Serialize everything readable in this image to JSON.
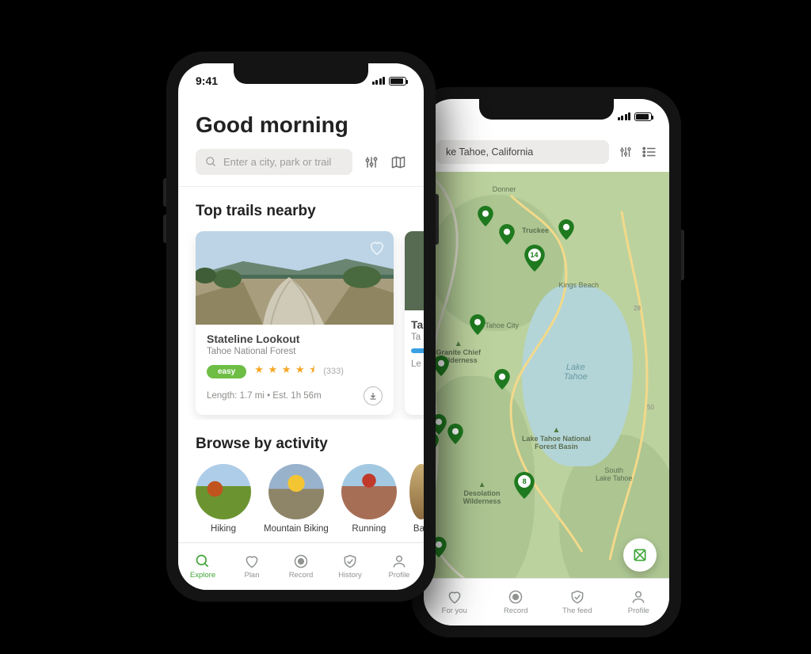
{
  "statusbar": {
    "time": "9:41"
  },
  "front": {
    "greeting": "Good morning",
    "search_placeholder": "Enter a city, park or trail",
    "section_nearby": "Top trails nearby",
    "section_activity": "Browse by activity",
    "trails": [
      {
        "title": "Stateline Lookout",
        "subtitle": "Tahoe National Forest",
        "difficulty": "easy",
        "reviews": "(333)",
        "length": "Length: 1.7 mi  •  Est. 1h 56m"
      },
      {
        "title_prefix": "Ta",
        "subtitle_prefix": "Ta",
        "length_prefix": "Le"
      }
    ],
    "activities": [
      {
        "label": "Hiking"
      },
      {
        "label": "Mountain Biking"
      },
      {
        "label": "Running"
      },
      {
        "label_prefix": "Bac"
      }
    ],
    "tabs": [
      {
        "label": "Explore",
        "active": true
      },
      {
        "label": "Plan"
      },
      {
        "label": "Record"
      },
      {
        "label": "History"
      },
      {
        "label": "Profile"
      }
    ]
  },
  "back": {
    "location_display": "ke Tahoe, California",
    "location_full": "Lake Tahoe, California",
    "map_labels": {
      "truckee": "Truckee",
      "donner": "Donner",
      "kings": "Kings Beach",
      "tahoe_city": "Tahoe City",
      "granite": "Granite Chief\nWilderness",
      "lake": "Lake\nTahoe",
      "basin": "Lake Tahoe National\nForest Basin",
      "desolation": "Desolation\nWilderness",
      "south": "South\nLake Tahoe",
      "national": "ational"
    },
    "cluster_counts": {
      "upper": "14",
      "lower": "8"
    },
    "tabs": [
      {
        "label": "For you"
      },
      {
        "label": "Record"
      },
      {
        "label": "The feed"
      },
      {
        "label": "Profile"
      }
    ]
  }
}
